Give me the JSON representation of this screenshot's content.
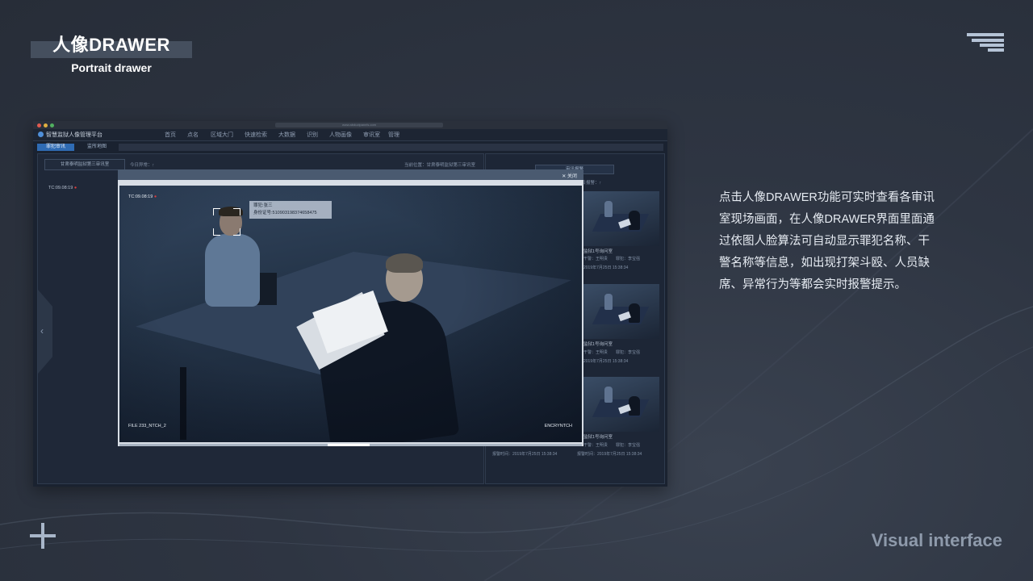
{
  "header": {
    "title": "人像DRAWER",
    "subtitle": "Portrait drawer"
  },
  "description": "点击人像DRAWER功能可实时查看各审讯室现场画面，在人像DRAWER界面里面通过依图人脸算法可自动显示罪犯名称、干警名称等信息，如出现打架斗殴、人员缺席、异常行为等都会实时报警提示。",
  "footer": {
    "label": "Visual interface"
  },
  "colors": {
    "accent": "#2f6bb3",
    "alert": "#e03c3c"
  },
  "app": {
    "url": "www.abductpanels.com",
    "title": "智慧监狱人像管理平台",
    "nav": [
      "首页",
      "点名",
      "区域大门",
      "快速检索",
      "大数据",
      "识别",
      "人物画像",
      "审讯室",
      "管理"
    ],
    "tabs": [
      "罪犯审讯",
      "监所地图"
    ],
    "location_select": "甘肃泰明监狱第三审讯室",
    "today_abnormal": "今日异常：↑",
    "current_location": "当前位置：甘肃泰明监狱第三审讯室",
    "timecode": "TC:09.08:19"
  },
  "right_panel": {
    "button": "审讯报警",
    "today_alert": "今日报警：↑",
    "cards": [
      {
        "room": "监狱1号询问室",
        "officer": "王明贵",
        "inmate": "李宝强",
        "time": "2019年7月25日  15:38:34"
      },
      {
        "room": "监狱1号询问室",
        "officer": "王明贵",
        "inmate": "李宝强",
        "time": "2019年7月25日  15:38:34"
      },
      {
        "room": "监狱1号询问室",
        "officer": "王明贵",
        "inmate": "李宝强",
        "time": "2019年7月25日  15:38:34"
      }
    ],
    "bottom_times": [
      "报警时间：2019年7月25日  15:38:34",
      "报警时间：2019年7月25日  15:38:34"
    ]
  },
  "modal": {
    "close_label": "✕ 关闭",
    "timecode": "TC:09.08:19",
    "info_name": "罪犯:张三",
    "info_id": "身份证号:510903198374658475",
    "file": "FILE 233_NTCH_2",
    "encrypt": "ENCRYNTCH",
    "progress": 0.5
  }
}
